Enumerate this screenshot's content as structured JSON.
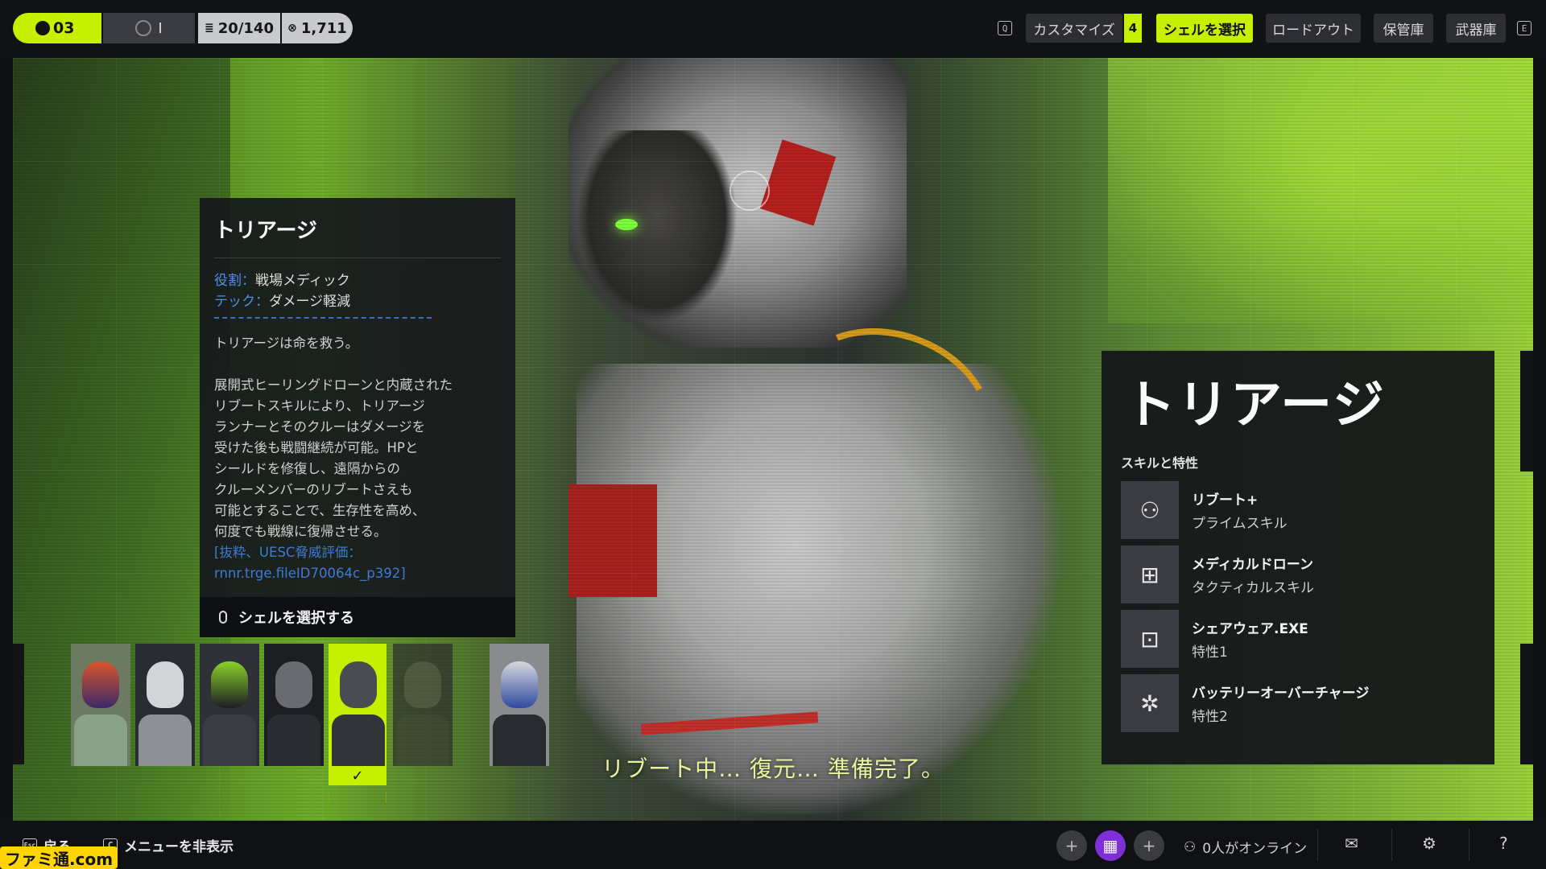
{
  "top_bar": {
    "level": "03",
    "rank_label": "I",
    "inventory": "20/140",
    "currency": "1,711",
    "key_left": "Q",
    "key_right": "E",
    "nav": [
      {
        "label": "カスタマイズ",
        "badge": "4"
      },
      {
        "label": "シェルを選択",
        "active": true
      },
      {
        "label": "ロードアウト"
      },
      {
        "label": "保管庫"
      },
      {
        "label": "武器庫"
      }
    ]
  },
  "info_panel": {
    "title": "トリアージ",
    "role_key": "役割：",
    "role_value": "戦場メディック",
    "tech_key": "テック：",
    "tech_value": "ダメージ軽減",
    "description": "トリアージは命を救う。\n\n展開式ヒーリングドローンと内蔵された\nリブートスキルにより、トリアージ\nランナーとそのクルーはダメージを\n受けた後も戦闘継続が可能。HPと\nシールドを修復し、遠隔からの\nクルーメンバーのリブートさえも\n可能とすることで、生存性を高め、\n何度でも戦線に復帰させる。",
    "quote": "[抜粋、UESC脅威評価：\nrnnr.trge.fileID70064c_p392]",
    "select_action": "シェルを選択する"
  },
  "skill_panel": {
    "shell_name": "トリアージ",
    "heading": "スキルと特性",
    "skills": [
      {
        "name": "リブート+",
        "type": "プライムスキル",
        "icon": "reboot-icon"
      },
      {
        "name": "メディカルドローン",
        "type": "タクティカルスキル",
        "icon": "drone-icon"
      },
      {
        "name": "シェアウェア.EXE",
        "type": "特性1",
        "icon": "shareware-icon"
      },
      {
        "name": "バッテリーオーバーチャージ",
        "type": "特性2",
        "icon": "battery-icon"
      }
    ]
  },
  "roster": {
    "selected_index": 4,
    "shells": [
      "shell-1",
      "shell-2",
      "shell-3",
      "shell-4",
      "shell-5",
      "shell-6",
      "shell-7"
    ]
  },
  "subtitle": "リブート中… 復元… 準備完了。",
  "bottom_bar": {
    "back_key": "Esc",
    "back_label": "戻る",
    "hide_key": "C",
    "hide_label": "メニューを非表示",
    "online_label": "0人がオンライン",
    "watermark": "ファミ通.com"
  },
  "colors": {
    "accent": "#c7f000",
    "link_blue": "#3e7ad6",
    "panel": "#16181c"
  }
}
